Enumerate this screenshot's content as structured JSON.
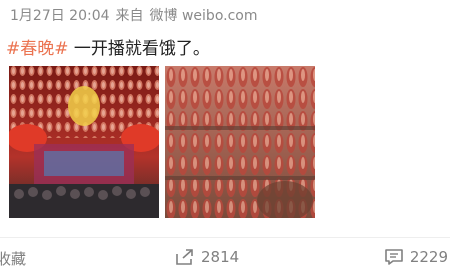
{
  "post": {
    "date": "1月27日 20:04",
    "source_prefix": "来自",
    "source_name": "微博 weibo.com",
    "hashtag": "#春晚#",
    "text": " 一开播就看饿了。"
  },
  "images": [
    {
      "name": "lanterns-stage-photo"
    },
    {
      "name": "cured-sausages-photo"
    }
  ],
  "actions": {
    "favorite_label": "收藏",
    "repost_count": "2814",
    "comment_count": "2229"
  },
  "colors": {
    "hashtag": "#eb7350",
    "meta_text": "#8a8a8a",
    "action_text": "#808080"
  },
  "icons": {
    "repost": "share-arrow-icon",
    "comment": "comment-bubble-icon"
  }
}
